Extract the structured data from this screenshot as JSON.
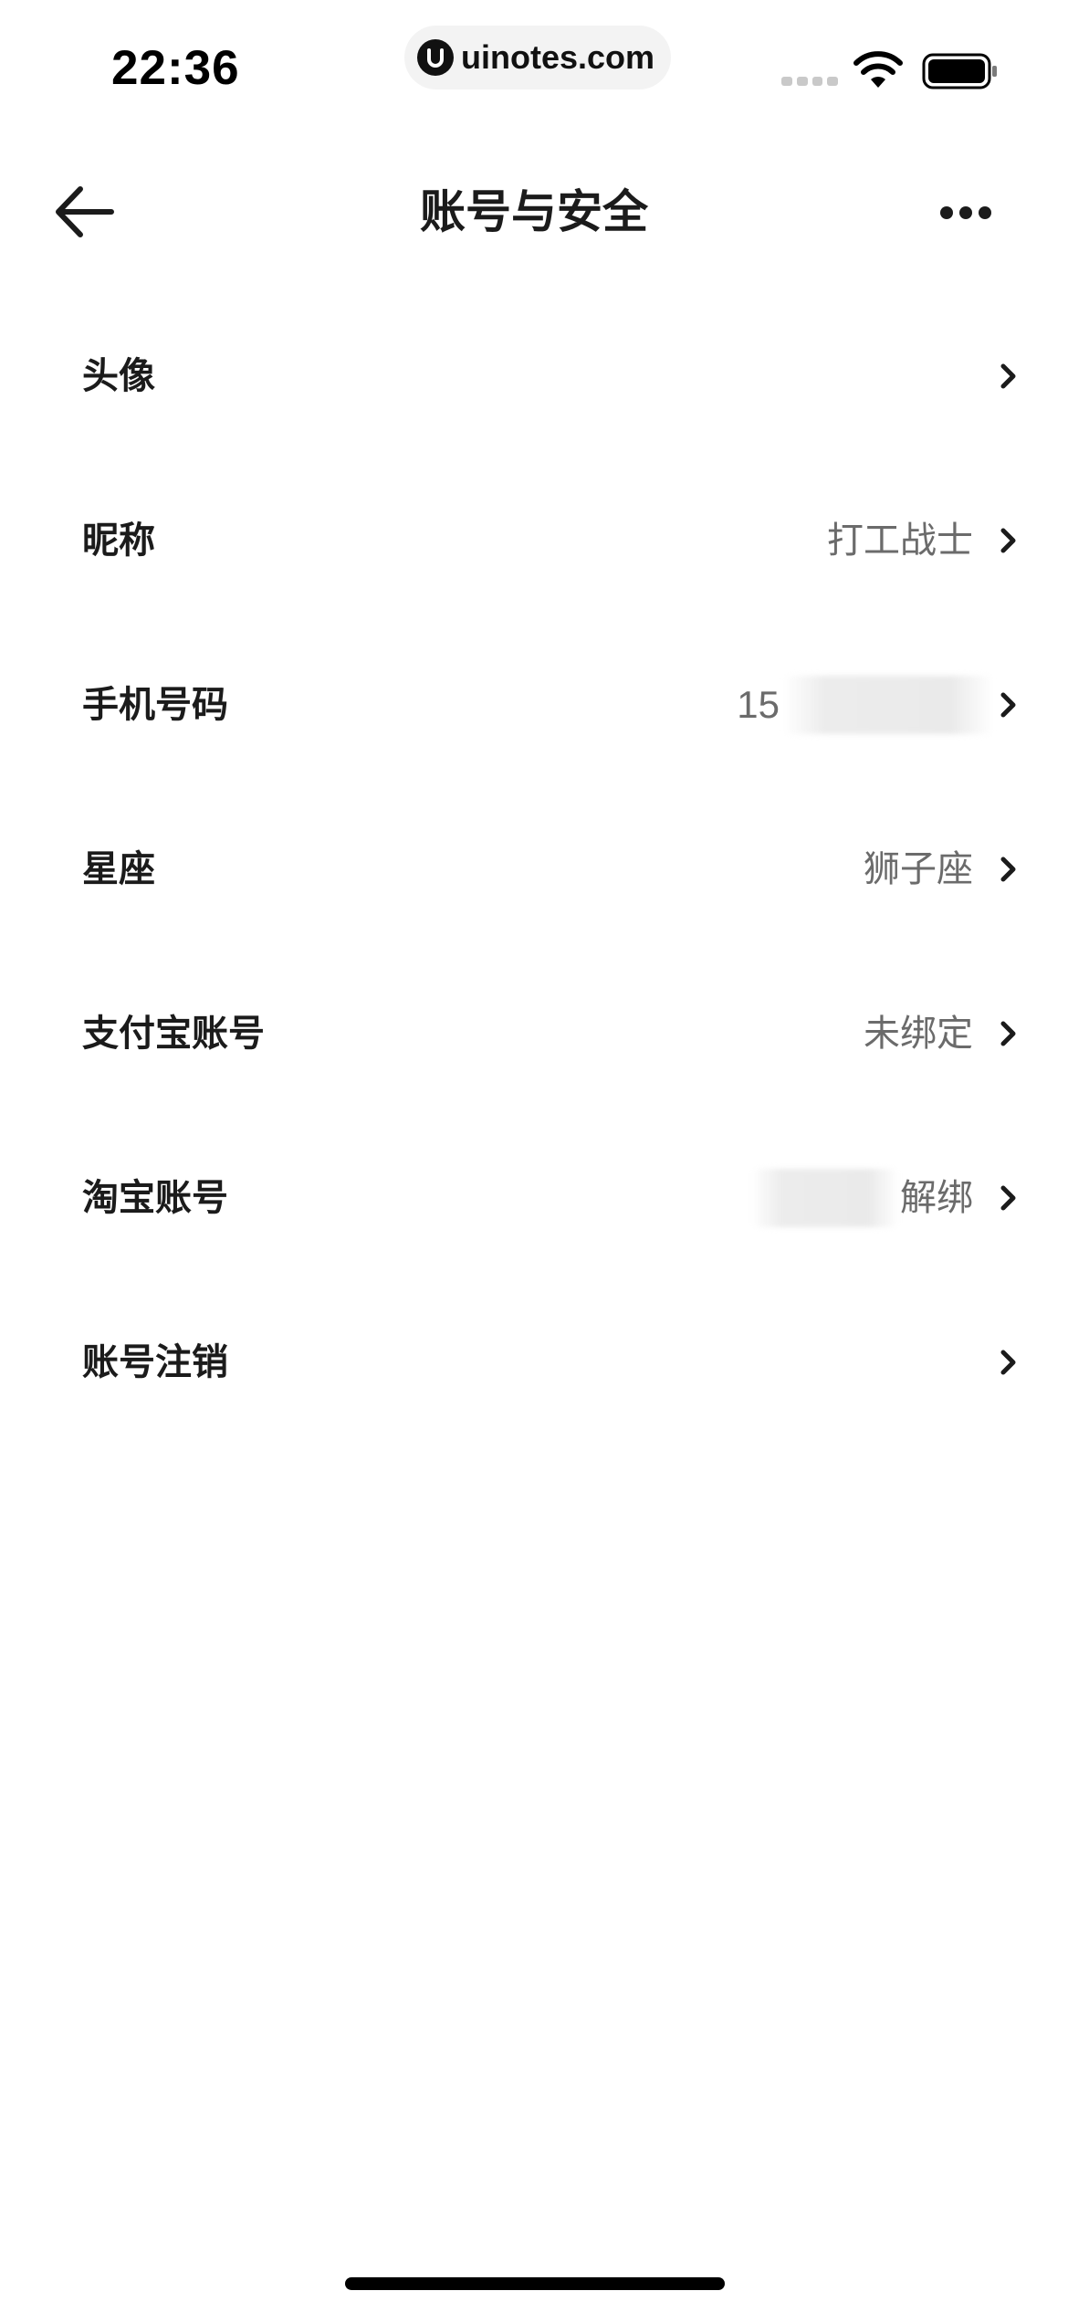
{
  "status_bar": {
    "time": "22:36",
    "watermark": "uinotes.com"
  },
  "nav": {
    "title": "账号与安全"
  },
  "rows": [
    {
      "label": "头像",
      "value": ""
    },
    {
      "label": "昵称",
      "value": "打工战士"
    },
    {
      "label": "手机号码",
      "value": "15"
    },
    {
      "label": "星座",
      "value": "狮子座"
    },
    {
      "label": "支付宝账号",
      "value": "未绑定"
    },
    {
      "label": "淘宝账号",
      "value": "解绑"
    },
    {
      "label": "账号注销",
      "value": ""
    }
  ],
  "icons": {
    "back": "arrow-left-icon",
    "more": "more-dots-icon",
    "chevron": "chevron-right-icon",
    "wifi": "wifi-icon",
    "battery": "battery-icon",
    "signal": "signal-icon"
  },
  "colors": {
    "background": "#ffffff",
    "text_primary": "#1b1b1b",
    "text_secondary": "#6b6b6b"
  }
}
